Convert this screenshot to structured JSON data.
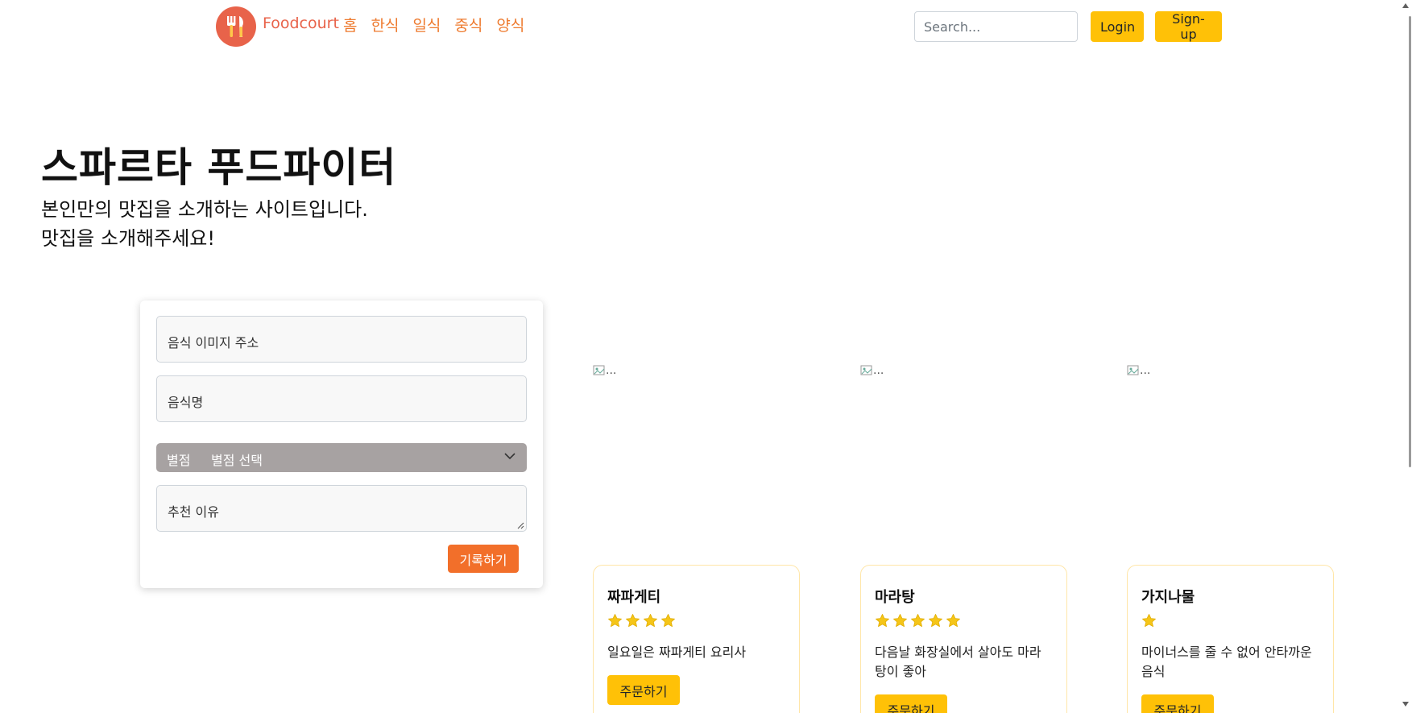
{
  "nav": {
    "logo_icon": "fork-knife-icon",
    "brand": "Foodcourt",
    "links": [
      "홈",
      "한식",
      "일식",
      "중식",
      "양식"
    ],
    "search_placeholder": "Search...",
    "login_label": "Login",
    "signup_label": "Sign-up",
    "accent_color": "#e8634a",
    "button_color": "#ffc107"
  },
  "hero": {
    "title": "스파르타 푸드파이터",
    "line1": "본인만의 맛집을 소개하는 사이트입니다.",
    "line2": "맛집을 소개해주세요!"
  },
  "form": {
    "image_placeholder": "음식 이미지 주소",
    "name_placeholder": "음식명",
    "select_label": "별점",
    "select_value": "별점 선택",
    "reason_placeholder": "추천 이유",
    "submit_label": "기록하기",
    "submit_color": "#f26f2a"
  },
  "cards": [
    {
      "image_alt": "...",
      "title": "짜파게티",
      "stars": 4,
      "description": "일요일은 짜파게티 요리사",
      "order_label": "주문하기"
    },
    {
      "image_alt": "...",
      "title": "마라탕",
      "stars": 5,
      "description": "다음날 화장실에서 살아도 마라탕이 좋아",
      "order_label": "주문하기"
    },
    {
      "image_alt": "...",
      "title": "가지나물",
      "stars": 1,
      "description": "마이너스를 줄 수 없어 안타까운 음식",
      "order_label": "주문하기"
    }
  ]
}
